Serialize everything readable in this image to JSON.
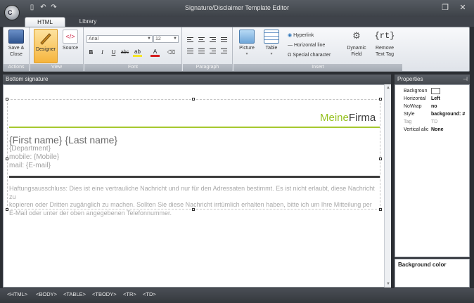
{
  "window": {
    "title": "Signature/Disclaimer Template Editor"
  },
  "tabs": [
    {
      "label": "HTML"
    },
    {
      "label": "Library"
    }
  ],
  "ribbon": {
    "actions": {
      "label": "Actions",
      "save_close": "Save &\nClose"
    },
    "view": {
      "label": "View",
      "designer": "Designer",
      "source": "Source"
    },
    "font": {
      "label": "Font",
      "family": "Arial",
      "size": "12"
    },
    "paragraph": {
      "label": "Paragraph"
    },
    "insert": {
      "label": "Insert",
      "picture": "Picture",
      "table": "Table",
      "hyperlink": "Hyperlink",
      "hline": "Horizontal line",
      "special_char": "Special character",
      "dynamic_field": "Dynamic\nField",
      "remove_text_tag": "Remove\nText Tag",
      "rt_symbol": "{rt}"
    }
  },
  "editor": {
    "header": "Bottom signature",
    "brand_meine": "Meine",
    "brand_firma": "Firma",
    "name_line": "{First name} {Last name}",
    "department": "{Department}",
    "mobile": "mobile: {Mobile}",
    "mail": "mail: {E-mail}",
    "disclaimer_lines": [
      "Haftungsausschluss: Dies ist eine vertrauliche Nachricht und nur für den Adressaten bestimmt. Es ist nicht erlaubt, diese Nachricht zu",
      "kopieren oder Dritten zugänglich zu machen. Sollten Sie diese Nachricht irrtümlich erhalten haben, bitte ich um Ihre Mitteilung per",
      "E-Mail oder unter der oben angegebenen Telefonnummer."
    ]
  },
  "properties": {
    "header": "Properties",
    "rows": [
      {
        "name": "Backgroun",
        "value": ""
      },
      {
        "name": "Horizontal",
        "value": "Left"
      },
      {
        "name": "NoWrap",
        "value": "no"
      },
      {
        "name": "Style",
        "value": "background: #"
      },
      {
        "name": "Tag",
        "value": "TD"
      },
      {
        "name": "Vertical alic",
        "value": "None"
      }
    ],
    "description": "Background color"
  },
  "status": {
    "crumbs": [
      "<HTML>",
      "<BODY>",
      "<TABLE>",
      "<TBODY>",
      "<TR>",
      "<TD>"
    ]
  },
  "colors": {
    "brand_green": "#95c11f",
    "accent_orange": "#f6b53d"
  }
}
